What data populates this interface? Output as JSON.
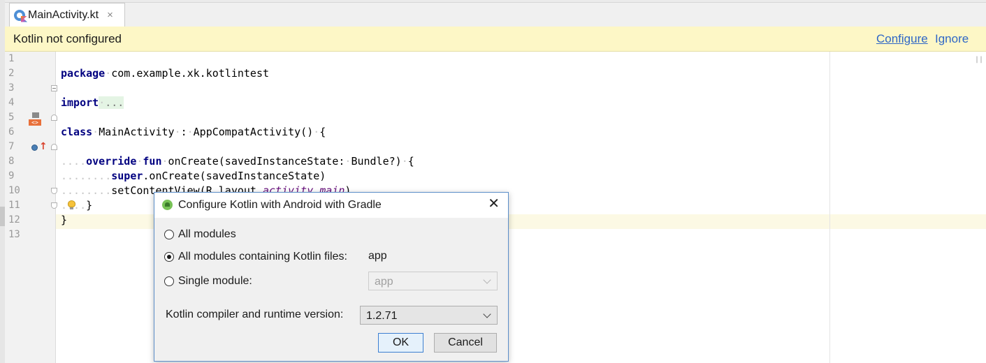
{
  "tab": {
    "label": "MainActivity.kt",
    "close": "×"
  },
  "notification": {
    "message": "Kotlin not configured",
    "configure": "Configure",
    "ignore": "Ignore"
  },
  "editor": {
    "line_numbers": [
      "1",
      "2",
      "3",
      "4",
      "5",
      "6",
      "7",
      "8",
      "9",
      "10",
      "11",
      "12",
      "13"
    ],
    "lines": {
      "l1": {
        "kw": "package",
        "rest": "com.example.xk.kotlintest"
      },
      "l3": {
        "kw": "import",
        "folded": "..."
      },
      "l6": {
        "kw": "class",
        "name": "MainActivity",
        "sep": ":",
        "super": "AppCompatActivity()",
        "brace": "{"
      },
      "l8": {
        "indent": "....",
        "kw1": "override",
        "kw2": "fun",
        "rest": "onCreate(savedInstanceState:",
        "type": "Bundle?)",
        "brace": "{"
      },
      "l9": {
        "indent": "........",
        "kw": "super",
        "rest": ".onCreate(savedInstanceState)"
      },
      "l10": {
        "indent": "........",
        "prefix": "setContentView(R.layout.",
        "ital": "activity_main",
        "suffix": ")"
      },
      "l11": {
        "indent": "....",
        "brace": "}"
      },
      "l12": {
        "brace": "}"
      }
    },
    "icon_impl_text": "<>",
    "icon_override_arrow": "↑",
    "scroll_indicator": "||"
  },
  "dialog": {
    "title": "Configure Kotlin with Android with Gradle",
    "close": "✕",
    "options": {
      "all_modules": "All modules",
      "all_kotlin": "All modules containing Kotlin files:",
      "single": "Single module:"
    },
    "selected_option": "all_kotlin",
    "kotlin_modules_value": "app",
    "single_module_select": "app",
    "version_label": "Kotlin compiler and runtime version:",
    "version_value": "1.2.71",
    "ok": "OK",
    "cancel": "Cancel"
  },
  "colors": {
    "keyword": "#000080",
    "italic_field": "#660e7a",
    "notification_bg": "#fdf7c6",
    "link": "#2f67c6",
    "dialog_border": "#5b8ec9"
  }
}
